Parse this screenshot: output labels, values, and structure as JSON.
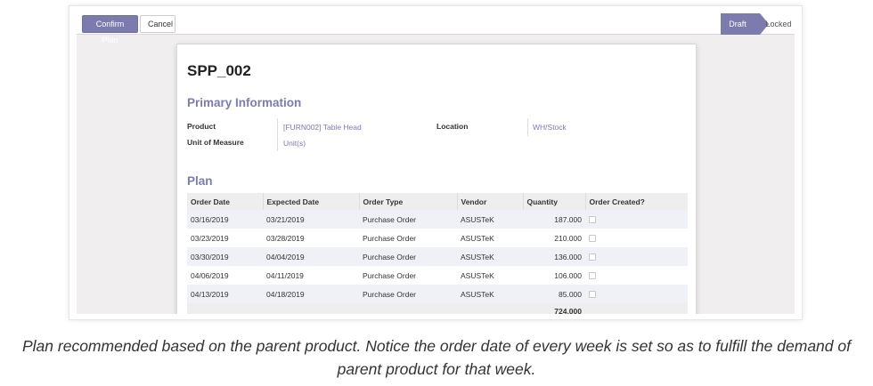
{
  "toolbar": {
    "confirm_label": "Confirm Plan",
    "cancel_label": "Cancel"
  },
  "status": {
    "stages": [
      "Draft",
      "Locked"
    ],
    "active": "Draft"
  },
  "record": {
    "name": "SPP_002",
    "primary_section": "Primary Information",
    "fields": {
      "product_label": "Product",
      "product_value": "[FURN002] Table Head",
      "uom_label": "Unit of Measure",
      "uom_value": "Unit(s)",
      "location_label": "Location",
      "location_value": "WH/Stock"
    },
    "plan_section": "Plan"
  },
  "plan_table": {
    "headers": [
      "Order Date",
      "Expected Date",
      "Order Type",
      "Vendor",
      "Quantity",
      "Order Created?"
    ],
    "rows": [
      [
        "03/16/2019",
        "03/21/2019",
        "Purchase Order",
        "ASUSTeK",
        "187.000"
      ],
      [
        "03/23/2019",
        "03/28/2019",
        "Purchase Order",
        "ASUSTeK",
        "210.000"
      ],
      [
        "03/30/2019",
        "04/04/2019",
        "Purchase Order",
        "ASUSTeK",
        "136.000"
      ],
      [
        "04/06/2019",
        "04/11/2019",
        "Purchase Order",
        "ASUSTeK",
        "106.000"
      ],
      [
        "04/13/2019",
        "04/18/2019",
        "Purchase Order",
        "ASUSTeK",
        "85.000"
      ]
    ],
    "order_created": [
      false,
      false,
      false,
      false,
      false
    ],
    "total_quantity": "724.000"
  },
  "caption": "Plan recommended based on the parent product. Notice the order date of every week is set so as to fulfill the demand of parent product for that week.",
  "colors": {
    "accent": "#7c7bad",
    "sheet_bg": "#ffffff",
    "app_bg": "#f0eeee"
  }
}
